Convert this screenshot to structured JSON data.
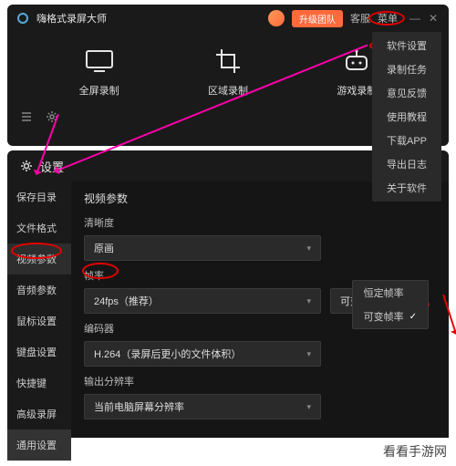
{
  "top_window": {
    "title": "嗨格式录屏大师",
    "upgrade": "升级团队",
    "nav_service": "客服",
    "nav_menu": "菜单",
    "modes": [
      {
        "label": "全屏录制"
      },
      {
        "label": "区域录制"
      },
      {
        "label": "游戏录制"
      }
    ],
    "menu": [
      "软件设置",
      "录制任务",
      "意见反馈",
      "使用教程",
      "下载APP",
      "导出日志",
      "关于软件"
    ]
  },
  "settings": {
    "title": "设置",
    "sidebar": [
      "保存目录",
      "文件格式",
      "视频参数",
      "音频参数",
      "鼠标设置",
      "键盘设置",
      "快捷键",
      "高级录屏"
    ],
    "sidebar_general": "通用设置",
    "section": "视频参数",
    "clarity_label": "清晰度",
    "clarity_value": "原画",
    "fps_label": "帧率",
    "fps_value": "24fps（推荐）",
    "fps_mode": "可变帧率",
    "fps_options": [
      "恒定帧率",
      "可变帧率"
    ],
    "encoder_label": "编码器",
    "encoder_value": "H.264（录屏后更小的文件体积）",
    "output_label": "输出分辨率",
    "output_value": "当前电脑屏幕分辨率"
  },
  "watermark": "看看手游网"
}
